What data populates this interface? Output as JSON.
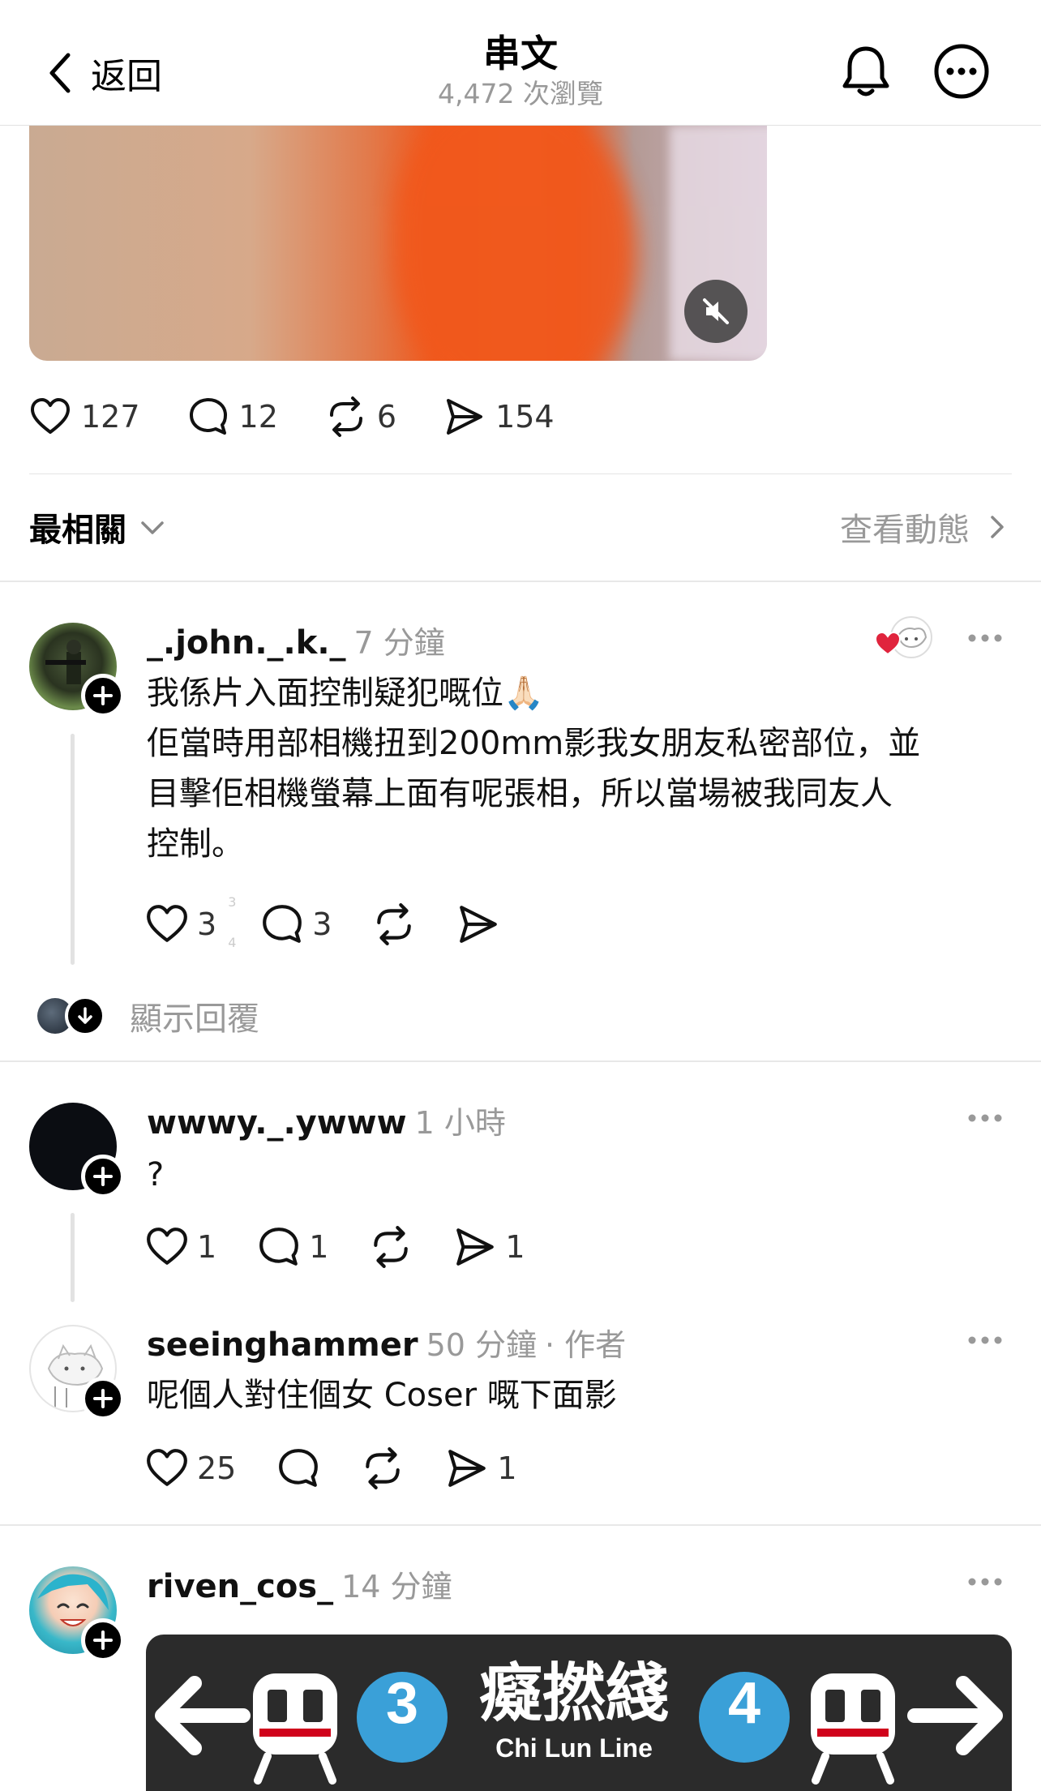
{
  "header": {
    "back_label": "返回",
    "title": "串文",
    "subtitle": "4,472 次瀏覽"
  },
  "post": {
    "actions": {
      "likes": "127",
      "comments": "12",
      "reposts": "6",
      "shares": "154"
    }
  },
  "sort": {
    "label": "最相關",
    "activity_label": "查看動態"
  },
  "comments": [
    {
      "username": "_.john._.k._",
      "time": "7 分鐘",
      "text": [
        "我係片入面控制疑犯嘅位🙏🏻",
        "佢當時用部相機扭到200mm影我女朋友私密部位，並",
        "目擊佢相機螢幕上面有呢張相，所以當場被我同友人",
        "控制。"
      ],
      "likes": "3",
      "replies": "3",
      "like_ticker_top": "3",
      "like_ticker_bottom": "4"
    },
    {
      "username": "wwwy._.ywww",
      "time": "1 小時",
      "text": [
        "?"
      ],
      "likes": "1",
      "replies": "1",
      "shares": "1"
    },
    {
      "username": "seeinghammer",
      "time": "50 分鐘",
      "author_tag": "· 作者",
      "text": [
        "呢個人對住個女 Coser 嘅下面影"
      ],
      "likes": "25",
      "shares": "1"
    },
    {
      "username": "riven_cos_",
      "time": "14 分鐘",
      "banner": {
        "line_name_zh": "癡撚綫",
        "line_name_en": "Chi Lun Line",
        "left_number": "3",
        "right_number": "4"
      }
    }
  ],
  "show_replies_label": "顯示回覆",
  "colors": {
    "accent_red": "#e0243d",
    "muted_text": "#999999",
    "line_badge_blue": "#3aa0d8"
  }
}
